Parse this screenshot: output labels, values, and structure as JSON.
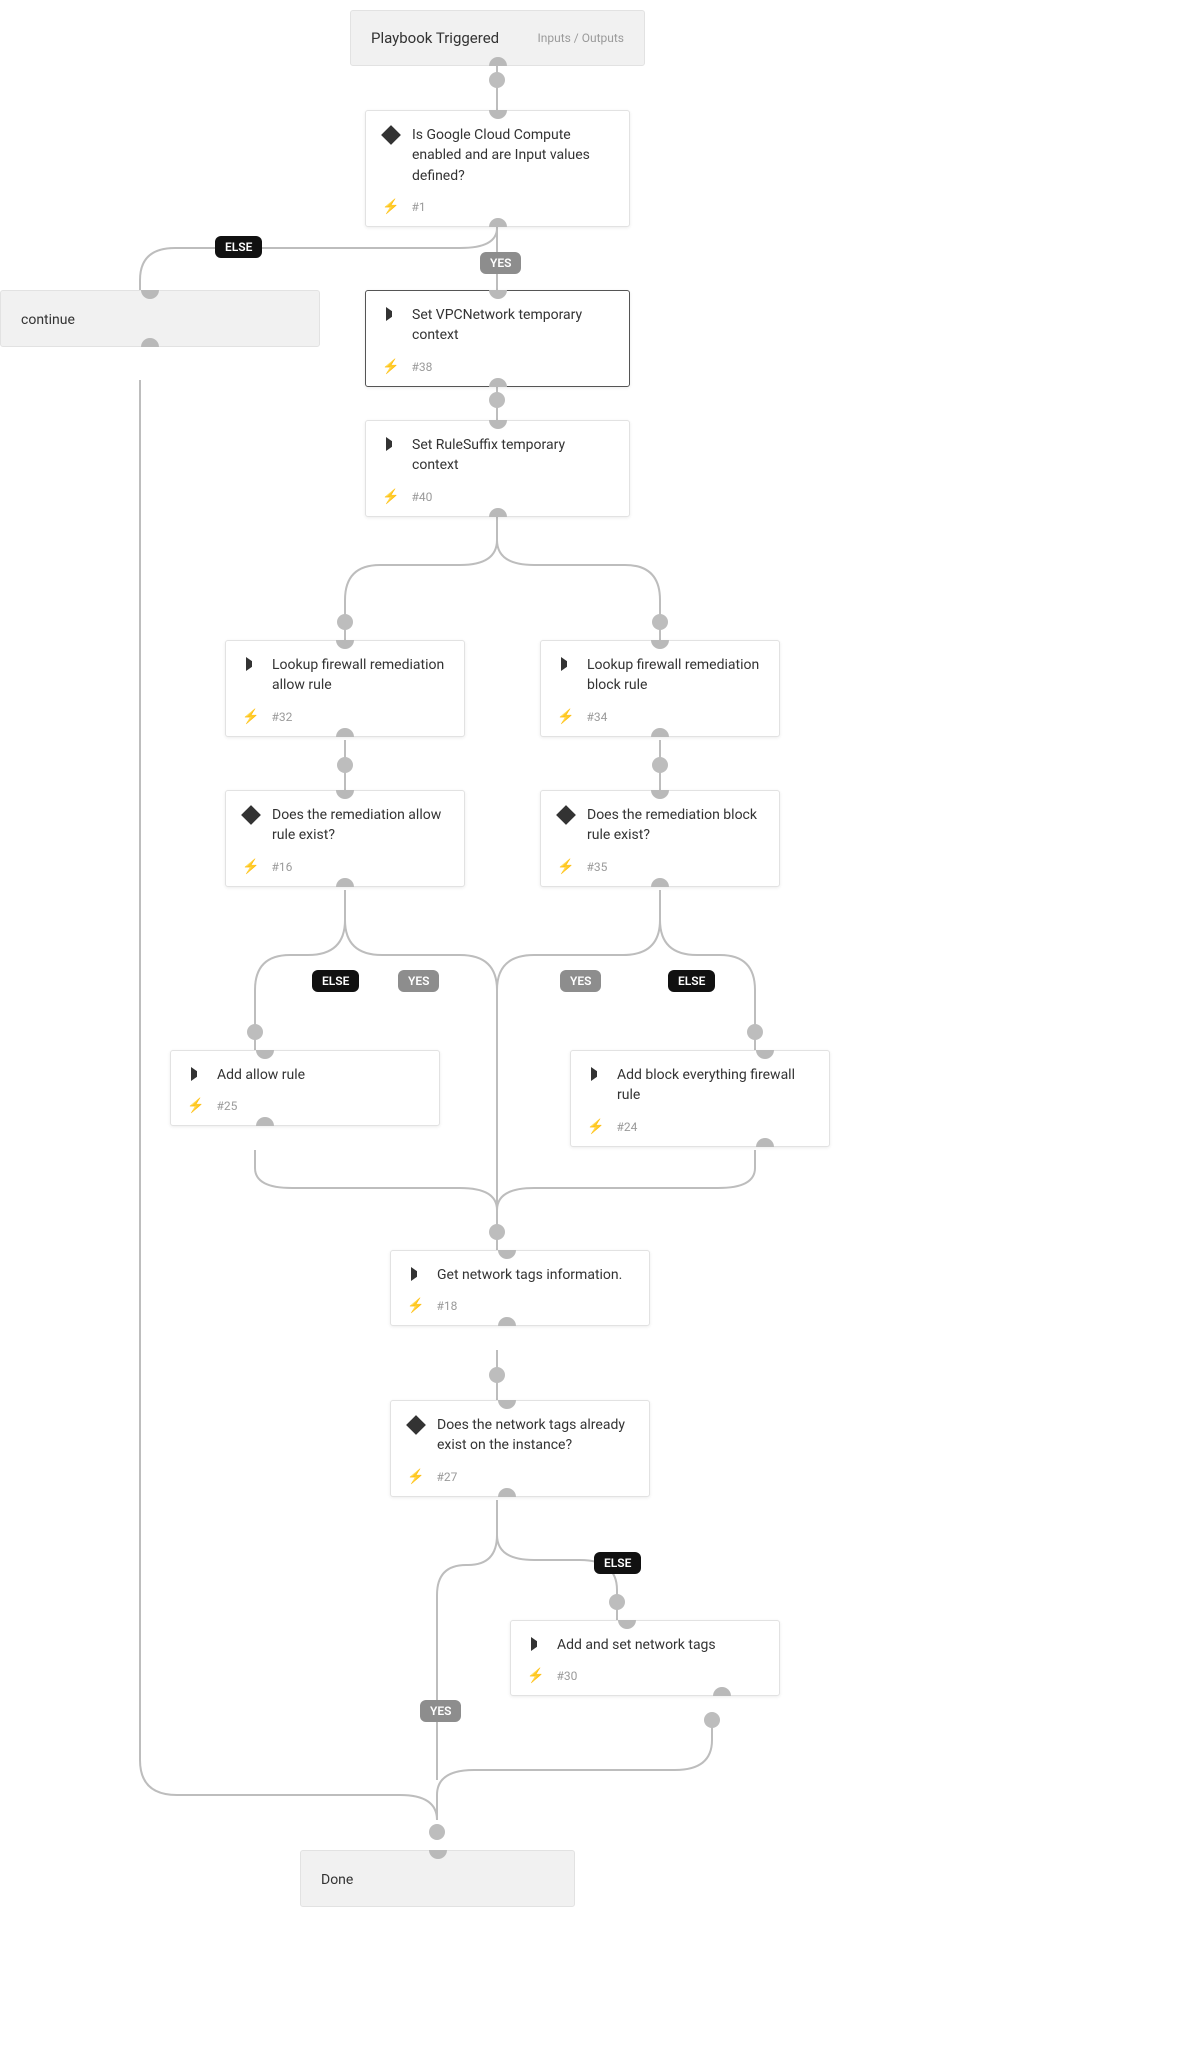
{
  "header": {
    "title": "Playbook Triggered",
    "io_label": "Inputs / Outputs"
  },
  "labels": {
    "yes": "YES",
    "else": "ELSE"
  },
  "nodes": {
    "n1": {
      "title": "Is Google Cloud Compute enabled and are Input values defined?",
      "num": "#1",
      "type": "decision"
    },
    "n38": {
      "title": "Set VPCNetwork temporary context",
      "num": "#38",
      "type": "action"
    },
    "n40": {
      "title": "Set RuleSuffix temporary context",
      "num": "#40",
      "type": "action"
    },
    "n32": {
      "title": "Lookup firewall remediation allow rule",
      "num": "#32",
      "type": "action"
    },
    "n34": {
      "title": "Lookup firewall remediation block rule",
      "num": "#34",
      "type": "action"
    },
    "n16": {
      "title": "Does the remediation allow rule exist?",
      "num": "#16",
      "type": "decision"
    },
    "n35": {
      "title": "Does the remediation block rule exist?",
      "num": "#35",
      "type": "decision"
    },
    "n25": {
      "title": "Add allow rule",
      "num": "#25",
      "type": "action"
    },
    "n24": {
      "title": "Add block everything firewall rule",
      "num": "#24",
      "type": "action"
    },
    "n18": {
      "title": "Get network tags information.",
      "num": "#18",
      "type": "action"
    },
    "n27": {
      "title": "Does the network tags already exist on the instance?",
      "num": "#27",
      "type": "decision"
    },
    "n30": {
      "title": "Add and set network tags",
      "num": "#30",
      "type": "action"
    }
  },
  "continue_label": "continue",
  "done_label": "Done"
}
